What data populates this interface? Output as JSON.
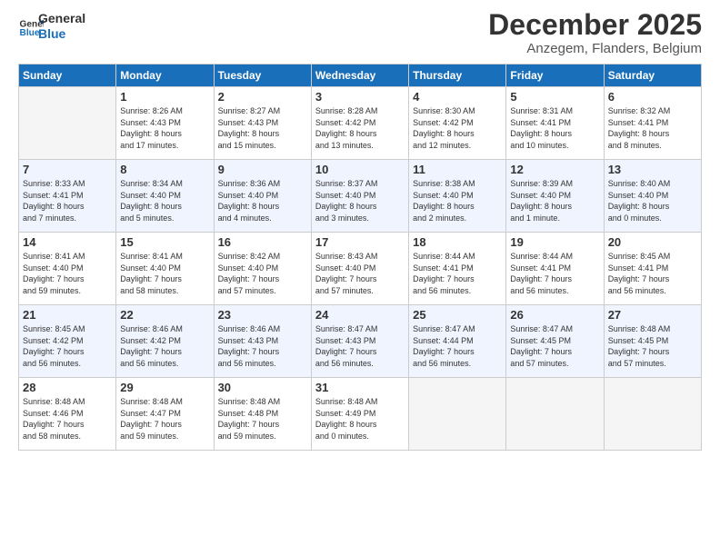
{
  "logo": {
    "line1": "General",
    "line2": "Blue"
  },
  "title": "December 2025",
  "location": "Anzegem, Flanders, Belgium",
  "days_of_week": [
    "Sunday",
    "Monday",
    "Tuesday",
    "Wednesday",
    "Thursday",
    "Friday",
    "Saturday"
  ],
  "weeks": [
    [
      {
        "day": null,
        "info": null
      },
      {
        "day": "1",
        "info": "Sunrise: 8:26 AM\nSunset: 4:43 PM\nDaylight: 8 hours\nand 17 minutes."
      },
      {
        "day": "2",
        "info": "Sunrise: 8:27 AM\nSunset: 4:43 PM\nDaylight: 8 hours\nand 15 minutes."
      },
      {
        "day": "3",
        "info": "Sunrise: 8:28 AM\nSunset: 4:42 PM\nDaylight: 8 hours\nand 13 minutes."
      },
      {
        "day": "4",
        "info": "Sunrise: 8:30 AM\nSunset: 4:42 PM\nDaylight: 8 hours\nand 12 minutes."
      },
      {
        "day": "5",
        "info": "Sunrise: 8:31 AM\nSunset: 4:41 PM\nDaylight: 8 hours\nand 10 minutes."
      },
      {
        "day": "6",
        "info": "Sunrise: 8:32 AM\nSunset: 4:41 PM\nDaylight: 8 hours\nand 8 minutes."
      }
    ],
    [
      {
        "day": "7",
        "info": "Sunrise: 8:33 AM\nSunset: 4:41 PM\nDaylight: 8 hours\nand 7 minutes."
      },
      {
        "day": "8",
        "info": "Sunrise: 8:34 AM\nSunset: 4:40 PM\nDaylight: 8 hours\nand 5 minutes."
      },
      {
        "day": "9",
        "info": "Sunrise: 8:36 AM\nSunset: 4:40 PM\nDaylight: 8 hours\nand 4 minutes."
      },
      {
        "day": "10",
        "info": "Sunrise: 8:37 AM\nSunset: 4:40 PM\nDaylight: 8 hours\nand 3 minutes."
      },
      {
        "day": "11",
        "info": "Sunrise: 8:38 AM\nSunset: 4:40 PM\nDaylight: 8 hours\nand 2 minutes."
      },
      {
        "day": "12",
        "info": "Sunrise: 8:39 AM\nSunset: 4:40 PM\nDaylight: 8 hours\nand 1 minute."
      },
      {
        "day": "13",
        "info": "Sunrise: 8:40 AM\nSunset: 4:40 PM\nDaylight: 8 hours\nand 0 minutes."
      }
    ],
    [
      {
        "day": "14",
        "info": "Sunrise: 8:41 AM\nSunset: 4:40 PM\nDaylight: 7 hours\nand 59 minutes."
      },
      {
        "day": "15",
        "info": "Sunrise: 8:41 AM\nSunset: 4:40 PM\nDaylight: 7 hours\nand 58 minutes."
      },
      {
        "day": "16",
        "info": "Sunrise: 8:42 AM\nSunset: 4:40 PM\nDaylight: 7 hours\nand 57 minutes."
      },
      {
        "day": "17",
        "info": "Sunrise: 8:43 AM\nSunset: 4:40 PM\nDaylight: 7 hours\nand 57 minutes."
      },
      {
        "day": "18",
        "info": "Sunrise: 8:44 AM\nSunset: 4:41 PM\nDaylight: 7 hours\nand 56 minutes."
      },
      {
        "day": "19",
        "info": "Sunrise: 8:44 AM\nSunset: 4:41 PM\nDaylight: 7 hours\nand 56 minutes."
      },
      {
        "day": "20",
        "info": "Sunrise: 8:45 AM\nSunset: 4:41 PM\nDaylight: 7 hours\nand 56 minutes."
      }
    ],
    [
      {
        "day": "21",
        "info": "Sunrise: 8:45 AM\nSunset: 4:42 PM\nDaylight: 7 hours\nand 56 minutes."
      },
      {
        "day": "22",
        "info": "Sunrise: 8:46 AM\nSunset: 4:42 PM\nDaylight: 7 hours\nand 56 minutes."
      },
      {
        "day": "23",
        "info": "Sunrise: 8:46 AM\nSunset: 4:43 PM\nDaylight: 7 hours\nand 56 minutes."
      },
      {
        "day": "24",
        "info": "Sunrise: 8:47 AM\nSunset: 4:43 PM\nDaylight: 7 hours\nand 56 minutes."
      },
      {
        "day": "25",
        "info": "Sunrise: 8:47 AM\nSunset: 4:44 PM\nDaylight: 7 hours\nand 56 minutes."
      },
      {
        "day": "26",
        "info": "Sunrise: 8:47 AM\nSunset: 4:45 PM\nDaylight: 7 hours\nand 57 minutes."
      },
      {
        "day": "27",
        "info": "Sunrise: 8:48 AM\nSunset: 4:45 PM\nDaylight: 7 hours\nand 57 minutes."
      }
    ],
    [
      {
        "day": "28",
        "info": "Sunrise: 8:48 AM\nSunset: 4:46 PM\nDaylight: 7 hours\nand 58 minutes."
      },
      {
        "day": "29",
        "info": "Sunrise: 8:48 AM\nSunset: 4:47 PM\nDaylight: 7 hours\nand 59 minutes."
      },
      {
        "day": "30",
        "info": "Sunrise: 8:48 AM\nSunset: 4:48 PM\nDaylight: 7 hours\nand 59 minutes."
      },
      {
        "day": "31",
        "info": "Sunrise: 8:48 AM\nSunset: 4:49 PM\nDaylight: 8 hours\nand 0 minutes."
      },
      {
        "day": null,
        "info": null
      },
      {
        "day": null,
        "info": null
      },
      {
        "day": null,
        "info": null
      }
    ]
  ]
}
